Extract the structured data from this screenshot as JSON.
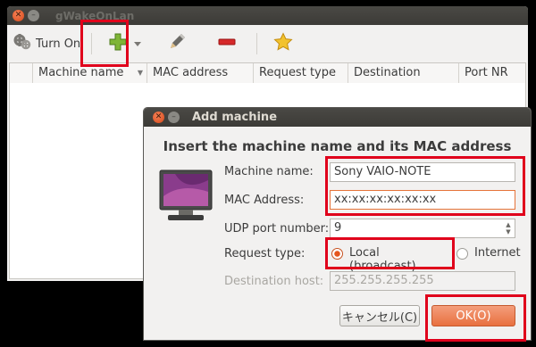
{
  "main_window": {
    "title": "gWakeOnLan",
    "toolbar": {
      "turn_on_label": "Turn On"
    },
    "columns": [
      "Machine name",
      "MAC address",
      "Request type",
      "Destination",
      "Port NR"
    ]
  },
  "dialog": {
    "title": "Add machine",
    "heading": "Insert the machine name and its MAC address",
    "machine_name_label": "Machine name:",
    "machine_name_value": "Sony VAIO-NOTE",
    "mac_label": "MAC Address:",
    "mac_value": "xx:xx:xx:xx:xx:xx",
    "udp_label": "UDP port number:",
    "udp_value": "9",
    "request_type_label": "Request type:",
    "request_options": [
      "Local (broadcast)",
      "Internet"
    ],
    "selected_request": "Local (broadcast)",
    "dest_label": "Destination host:",
    "dest_value": "255.255.255.255",
    "cancel_label": "キャンセル(C)",
    "ok_label": "OK(O)"
  },
  "colors": {
    "accent": "#e5561d",
    "highlight_box": "#e0001b",
    "titlebar": "#3c3b37"
  },
  "icons": [
    "power-machine-icon",
    "add-icon",
    "dropdown-arrow-icon",
    "edit-pencil-icon",
    "remove-icon",
    "favorite-star-icon",
    "computer-monitor-icon"
  ]
}
